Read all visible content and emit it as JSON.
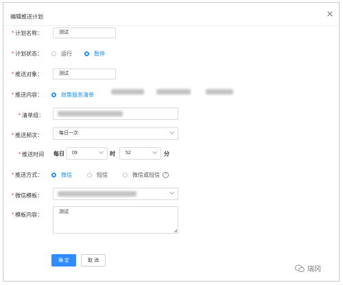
{
  "dialog": {
    "title": "编辑推送计划"
  },
  "form": {
    "plan_name": {
      "label": "计划名称：",
      "value": "测试"
    },
    "plan_status": {
      "label": "计划状态：",
      "options": [
        "运行",
        "暂停"
      ],
      "selected": "暂停"
    },
    "target": {
      "label": "推送对象：",
      "value": "测试"
    },
    "content": {
      "label": "推送内容：",
      "option": "政策服务清单"
    },
    "list_group": {
      "label": "清单组："
    },
    "frequency": {
      "label": "推送频次：",
      "value": "每日一次"
    },
    "time": {
      "label": "推送时间",
      "prefix": "每日",
      "hour": "09",
      "hour_unit": "时",
      "minute": "52",
      "minute_unit": "分"
    },
    "method": {
      "label": "推送方式：",
      "options": [
        "微信",
        "短信",
        "微信或短信"
      ],
      "selected": "微信"
    },
    "wechat_template": {
      "label": "微信模板："
    },
    "template_content": {
      "label": "模板内容：",
      "value": "测试"
    }
  },
  "buttons": {
    "confirm": "确 定",
    "cancel": "取 消"
  },
  "watermark": {
    "text": "瑞冈"
  },
  "colors": {
    "accent": "#1890ff",
    "required": "#f5222d"
  }
}
